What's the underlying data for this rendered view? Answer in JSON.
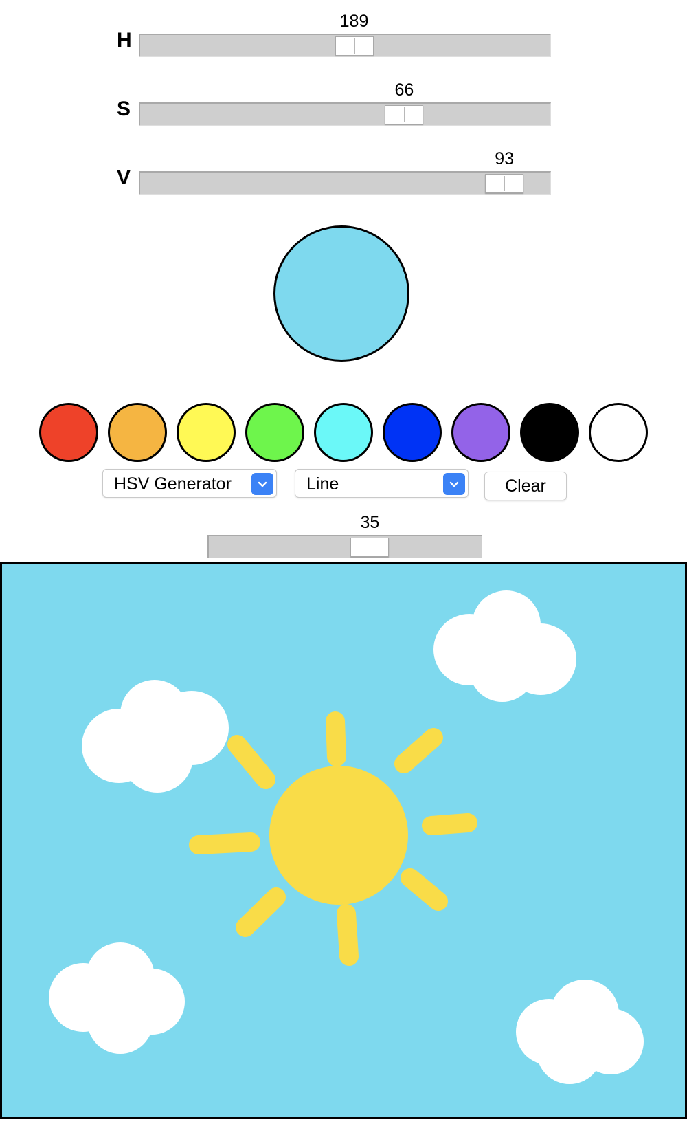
{
  "sliders": {
    "hue": {
      "label": "H",
      "value": "189",
      "fraction": 0.525
    },
    "saturation": {
      "label": "S",
      "value": "66",
      "fraction": 0.66
    },
    "value": {
      "label": "V",
      "value": "93",
      "fraction": 0.93
    }
  },
  "preview_color": "#7ed9ee",
  "palette": [
    "#ee4229",
    "#f5b542",
    "#fff955",
    "#6ef54c",
    "#6bf8f8",
    "#0033f5",
    "#9363e8",
    "#000000",
    "#ffffff"
  ],
  "controls": {
    "mode_select": "HSV Generator",
    "tool_select": "Line",
    "clear_label": "Clear"
  },
  "brush_size": {
    "value": "35",
    "fraction": 0.607
  },
  "canvas": {
    "background": "#7ed9ee",
    "sun_color": "#f9dc48",
    "cloud_color": "#ffffff"
  }
}
